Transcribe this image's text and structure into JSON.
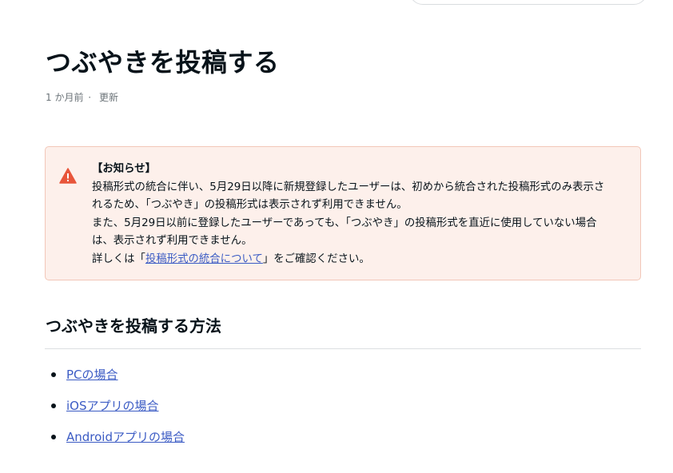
{
  "article": {
    "title": "つぶやきを投稿する",
    "meta": {
      "time_ago": "1 か月前",
      "separator": "·",
      "updated_label": "更新"
    }
  },
  "notice": {
    "icon": "warning-triangle-icon",
    "heading": "【お知らせ】",
    "line1": "投稿形式の統合に伴い、5月29日以降に新規登録したユーザーは、初めから統合された投稿形式のみ表示さ",
    "line2": "れるため、「つぶやき」の投稿形式は表示されず利用できません。",
    "line3": "また、5月29日以前に登録したユーザーであっても、「つぶやき」の投稿形式を直近に使用していない場合",
    "line4": "は、表示されず利用できません。",
    "line5_prefix": "詳しくは「",
    "line5_link": "投稿形式の統合について",
    "line5_suffix": "」をご確認ください。"
  },
  "section": {
    "title": "つぶやきを投稿する方法",
    "links": [
      {
        "label": "PCの場合"
      },
      {
        "label": "iOSアプリの場合"
      },
      {
        "label": "Androidアプリの場合"
      }
    ]
  },
  "colors": {
    "text": "#08131a",
    "link": "#3b5bc4",
    "notice_bg": "#fdf0eb",
    "notice_border": "#f2c7b8",
    "warning": "#e8553a"
  }
}
